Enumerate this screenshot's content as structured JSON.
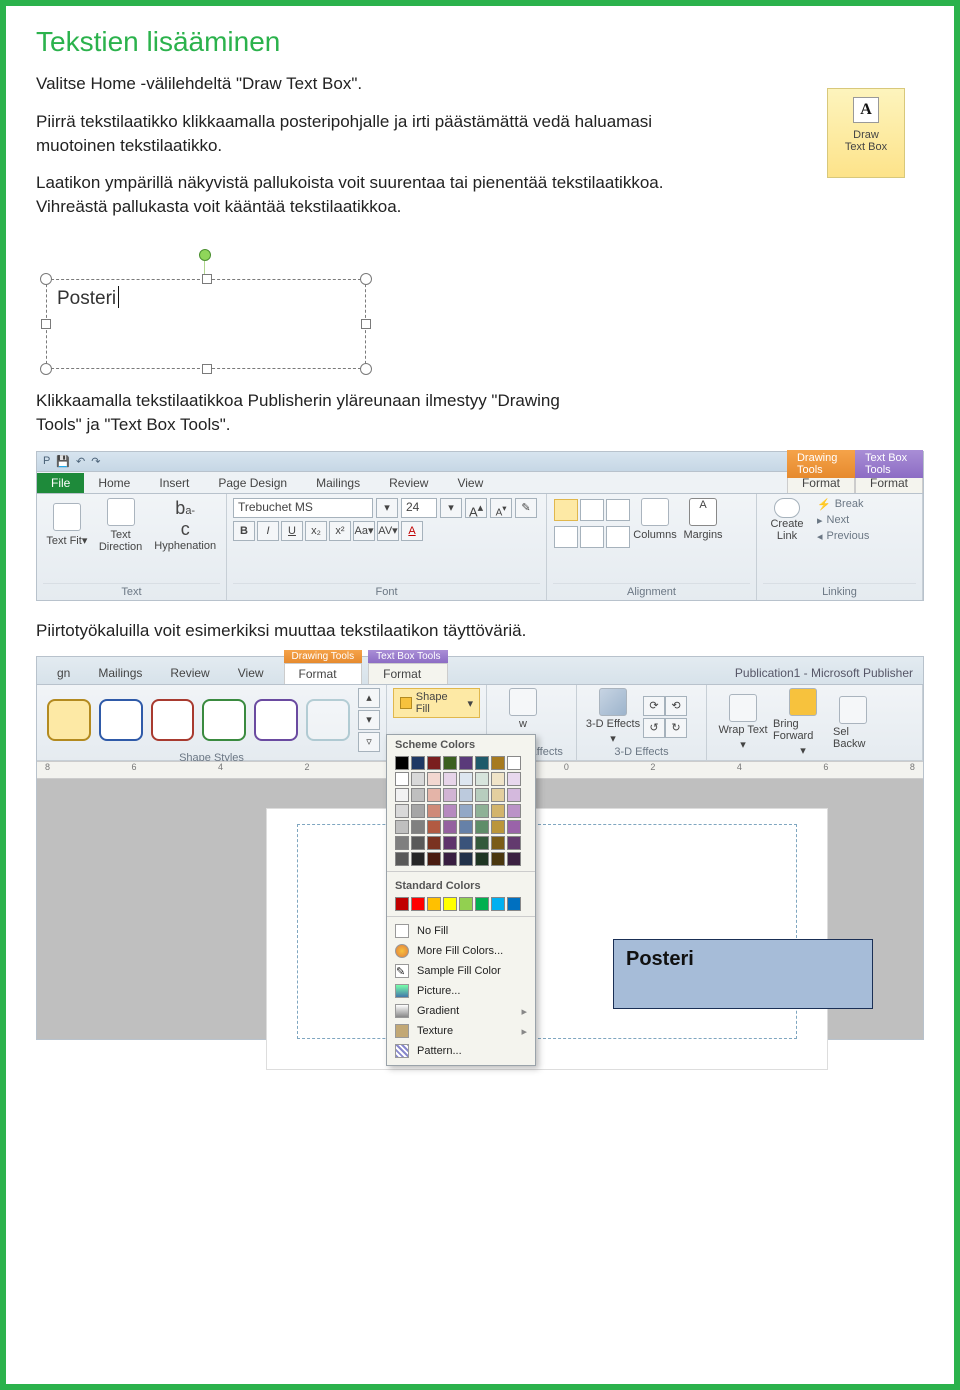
{
  "title": "Tekstien lisääminen",
  "para1": "Valitse Home -välilehdeltä \"Draw Text Box\".",
  "para2": "Piirrä tekstilaatikko klikkaamalla posteripohjalle ja irti päästämättä vedä haluamasi muotoinen tekstilaatikko.",
  "para3": "Laatikon ympärillä näkyvistä pallukoista voit suurentaa tai pienentää tekstilaatikkoa. Vihreästä pallukasta voit kääntää tekstilaatikkoa.",
  "para4": "Klikkaamalla tekstilaatikkoa Publisherin yläreunaan ilmestyy  \"Drawing Tools\" ja \"Text Box Tools\".",
  "para5": "Piirtotyökaluilla voit esimerkiksi muuttaa tekstilaatikon täyttöväriä.",
  "drawBtn": {
    "A": "A",
    "line1": "Draw",
    "line2": "Text Box"
  },
  "selectionText": "Posteri",
  "ribbon1": {
    "tabs": {
      "file": "File",
      "home": "Home",
      "insert": "Insert",
      "pageDesign": "Page Design",
      "mailings": "Mailings",
      "review": "Review",
      "view": "View"
    },
    "ctx": {
      "drawing": "Drawing Tools",
      "textbox": "Text Box Tools",
      "format1": "Format",
      "format2": "Format"
    },
    "text": {
      "fit": "Text Fit",
      "direction": "Text Direction",
      "hyph": "Hyphenation",
      "group": "Text"
    },
    "font": {
      "name": "Trebuchet MS",
      "size": "24",
      "bold": "B",
      "italic": "I",
      "underline": "U",
      "sub": "x₂",
      "sup": "x²",
      "case": "Aa",
      "spacing": "AV",
      "color": "A",
      "grow": "A",
      "shrink": "A",
      "clear": "✎",
      "group": "Font"
    },
    "align": {
      "columns": "Columns",
      "margins": "Margins",
      "group": "Alignment"
    },
    "link": {
      "create": "Create Link",
      "break": "Break",
      "next": "Next",
      "prev": "Previous",
      "group": "Linking"
    }
  },
  "ribbon2": {
    "tabs": {
      "gn": "gn",
      "mailings": "Mailings",
      "review": "Review",
      "view": "View"
    },
    "ctx": {
      "drawing": "Drawing Tools",
      "textbox": "Text Box Tools",
      "format1": "Format",
      "format2": "Format"
    },
    "appTitle": "Publication1  -  Microsoft Publisher",
    "shapeStyles": "Shape Styles",
    "shapeFill": "Shape Fill",
    "shadow": {
      "label": "adow Effects",
      "w": "w"
    },
    "threeD": {
      "btn": "3-D Effects",
      "group": "3-D Effects"
    },
    "arrange": {
      "wrap": "Wrap Text",
      "bring": "Bring Forward",
      "send": "Sel Backw"
    }
  },
  "colorDD": {
    "scheme": "Scheme Colors",
    "standard": "Standard Colors",
    "noFill": "No Fill",
    "more": "More Fill Colors...",
    "sample": "Sample Fill Color",
    "picture": "Picture...",
    "gradient": "Gradient",
    "texture": "Texture",
    "pattern": "Pattern...",
    "schemeRow1": [
      "#000000",
      "#1f3864",
      "#7a1f1f",
      "#3a5f1f",
      "#5a3a7a",
      "#1f5a6a",
      "#a67a1f",
      "#ffffff"
    ],
    "shades": [
      [
        "#ffffff",
        "#d9d9d9",
        "#f2d7d0",
        "#e7d4e8",
        "#dde6f0",
        "#d7e4dc",
        "#f0e4c8",
        "#e8d8ee"
      ],
      [
        "#f2f2f2",
        "#bfbfbf",
        "#e4b4a8",
        "#d1b4d4",
        "#bccadd",
        "#b7cdbe",
        "#e3cf9f",
        "#d4b9dd"
      ],
      [
        "#d9d9d9",
        "#a6a6a6",
        "#cf8a78",
        "#b68abf",
        "#93a8c6",
        "#8fb196",
        "#d2b46c",
        "#bb93c7"
      ],
      [
        "#bfbfbf",
        "#808080",
        "#b25a42",
        "#94619f",
        "#6681a8",
        "#5e8d68",
        "#bb963a",
        "#9a63a9"
      ],
      [
        "#7f7f7f",
        "#595959",
        "#7a3220",
        "#5e346c",
        "#3a537a",
        "#33593b",
        "#7a5c18",
        "#633a6e"
      ],
      [
        "#595959",
        "#262626",
        "#4a1c10",
        "#381e40",
        "#22324a",
        "#1e3522",
        "#4a370e",
        "#3b2141"
      ]
    ],
    "standardRow": [
      "#c00000",
      "#ff0000",
      "#ffc000",
      "#ffff00",
      "#92d050",
      "#00b050",
      "#00b0f0",
      "#0070c0"
    ]
  },
  "rulerMarks": [
    "8",
    "6",
    "4",
    "2",
    "0",
    "2",
    "0",
    "2",
    "4",
    "6",
    "8"
  ],
  "posterBlue": "Posteri"
}
